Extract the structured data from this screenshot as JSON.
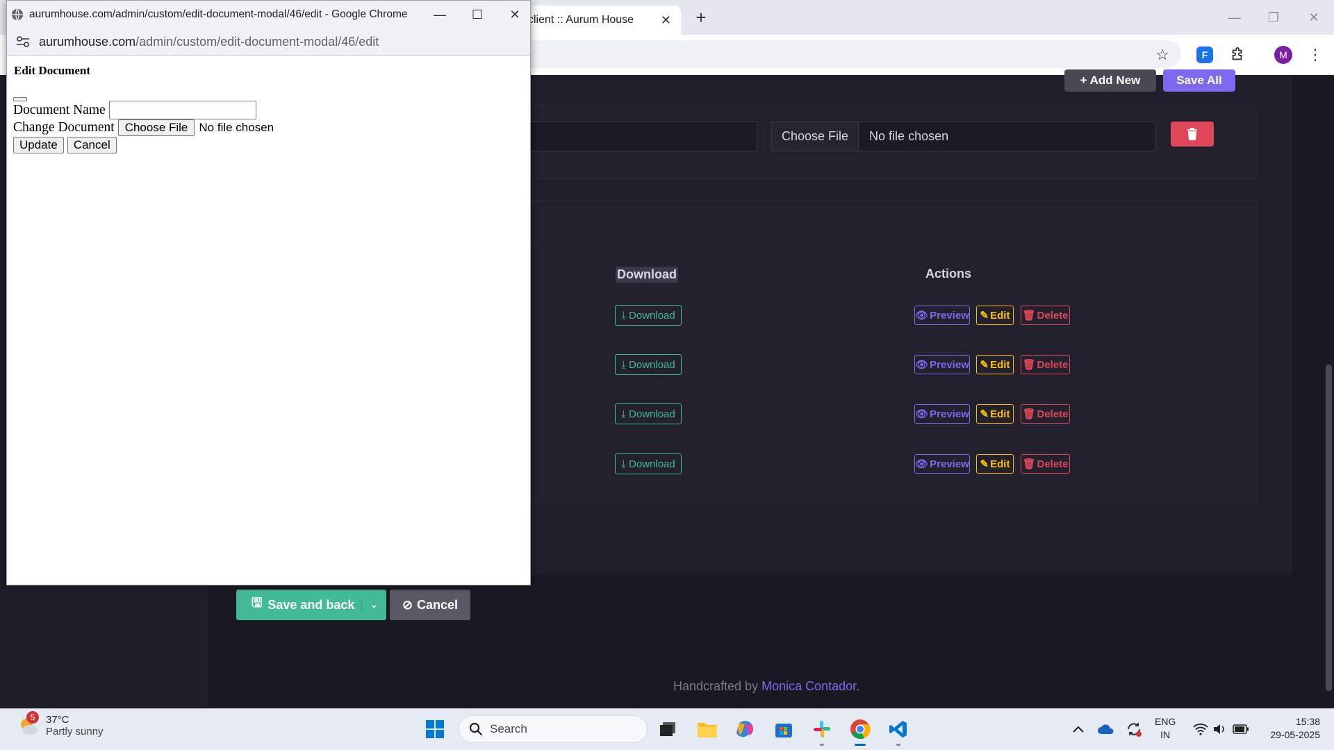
{
  "background_browser": {
    "tab_title": "client :: Aurum House",
    "tab_close": "✕",
    "new_tab": "+",
    "profile_initial": "M",
    "extension_label": "F"
  },
  "page": {
    "add_new_label": "+ Add New",
    "save_all_label": "Save All",
    "file_choose_label": "Choose File",
    "file_none_label": "No file chosen",
    "table_headers": {
      "download": "Download",
      "actions": "Actions"
    },
    "rows": [
      {
        "download": "⤓ Download",
        "preview": "Preview",
        "edit": "Edit",
        "delete": "Delete"
      },
      {
        "download": "⤓ Download",
        "preview": "Preview",
        "edit": "Edit",
        "delete": "Delete"
      },
      {
        "download": "⤓ Download",
        "preview": "Preview",
        "edit": "Edit",
        "delete": "Delete"
      },
      {
        "download": "⤓ Download",
        "preview": "Preview",
        "edit": "Edit",
        "delete": "Delete"
      }
    ],
    "save_and_back_label": "Save and back",
    "cancel_label": "Cancel",
    "footer_prefix": "Handcrafted by ",
    "footer_link": "Monica Contador",
    "footer_suffix": "."
  },
  "popup": {
    "window_title": "aurumhouse.com/admin/custom/edit-document-modal/46/edit - Google Chrome",
    "url_host": "aurumhouse.com",
    "url_path": "/admin/custom/edit-document-modal/46/edit",
    "heading": "Edit Document",
    "document_name_label": "Document Name",
    "document_name_value": "",
    "change_document_label": "Change Document",
    "choose_file_label": "Choose File",
    "no_file_label": "No file chosen",
    "update_label": "Update",
    "cancel_label": "Cancel"
  },
  "taskbar": {
    "weather_badge": "5",
    "temperature": "37°C",
    "condition": "Partly sunny",
    "search_placeholder": "Search",
    "language": "ENG",
    "region": "IN",
    "time": "15:38",
    "date": "29-05-2025"
  },
  "colors": {
    "accent_purple": "#7c69ef",
    "success_green": "#42ba96",
    "warning_yellow": "#ffc107",
    "danger_red": "#df4759",
    "page_bg": "#1a1922"
  }
}
